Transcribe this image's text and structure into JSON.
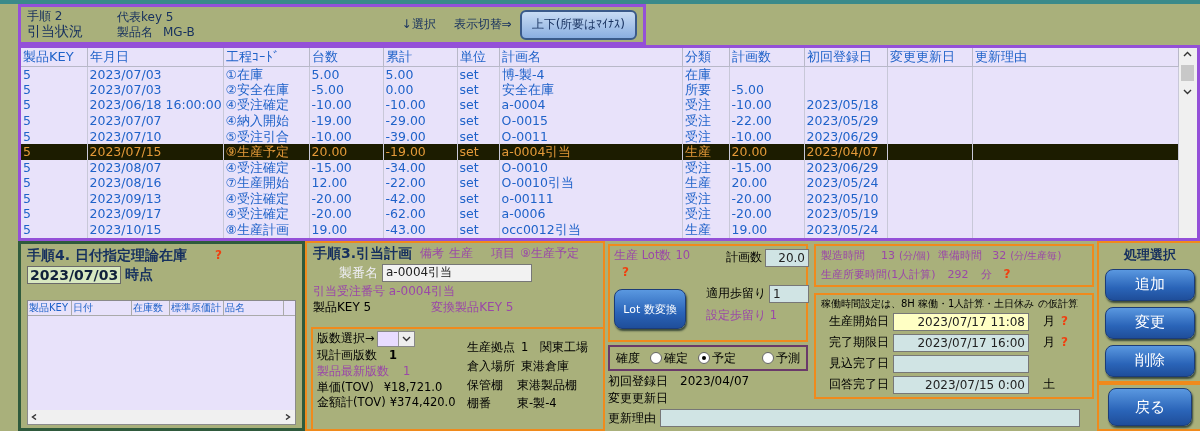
{
  "header": {
    "step": "手順 2",
    "title": "引当状況",
    "key_label": "代表key 5",
    "product_label": "製品名",
    "product_value": "MG-B",
    "select_hint": "↓選択",
    "toggle_label": "表示切替⇒",
    "toggle_button": "上下(所要はﾏｲﾅｽ)"
  },
  "table": {
    "columns": [
      "製品KEY",
      "年月日",
      "工程ｺｰﾄﾞ",
      "台数",
      "累計",
      "単位",
      "計画名",
      "分類",
      "計画数",
      "初回登録日",
      "変更更新日",
      "更新理由"
    ],
    "rows": [
      {
        "selected": false,
        "cells": [
          "5",
          "2023/07/03",
          "①在庫",
          "5.00",
          "5.00",
          "set",
          "博-製-4",
          "在庫",
          "",
          "",
          "",
          ""
        ]
      },
      {
        "selected": false,
        "cells": [
          "5",
          "2023/07/03",
          "②安全在庫",
          "-5.00",
          "0.00",
          "set",
          "安全在庫",
          "所要",
          "-5.00",
          "",
          "",
          ""
        ]
      },
      {
        "selected": false,
        "cells": [
          "5",
          "2023/06/18 16:00:00",
          "④受注確定",
          "-10.00",
          "-10.00",
          "set",
          "a-0004",
          "受注",
          "-10.00",
          "2023/05/18",
          "",
          ""
        ]
      },
      {
        "selected": false,
        "cells": [
          "5",
          "2023/07/07",
          "④納入開始",
          "-19.00",
          "-29.00",
          "set",
          "O-0015",
          "受注",
          "-22.00",
          "2023/05/29",
          "",
          ""
        ]
      },
      {
        "selected": false,
        "cells": [
          "5",
          "2023/07/10",
          "⑤受注引合",
          "-10.00",
          "-39.00",
          "set",
          "O-0011",
          "受注",
          "-10.00",
          "2023/06/29",
          "",
          ""
        ]
      },
      {
        "selected": true,
        "cells": [
          "5",
          "2023/07/15",
          "⑨生産予定",
          "20.00",
          "-19.00",
          "set",
          "a-0004引当",
          "生産",
          "20.00",
          "2023/04/07",
          "",
          ""
        ]
      },
      {
        "selected": false,
        "cells": [
          "5",
          "2023/08/07",
          "④受注確定",
          "-15.00",
          "-34.00",
          "set",
          "O-0010",
          "受注",
          "-15.00",
          "2023/06/29",
          "",
          ""
        ]
      },
      {
        "selected": false,
        "cells": [
          "5",
          "2023/08/16",
          "⑦生産開始",
          "12.00",
          "-22.00",
          "set",
          "O-0010引当",
          "生産",
          "20.00",
          "2023/05/24",
          "",
          ""
        ]
      },
      {
        "selected": false,
        "cells": [
          "5",
          "2023/09/13",
          "④受注確定",
          "-20.00",
          "-42.00",
          "set",
          "o-00111",
          "受注",
          "-20.00",
          "2023/05/10",
          "",
          ""
        ]
      },
      {
        "selected": false,
        "cells": [
          "5",
          "2023/09/17",
          "④受注確定",
          "-20.00",
          "-62.00",
          "set",
          "a-0006",
          "受注",
          "-20.00",
          "2023/05/19",
          "",
          ""
        ]
      },
      {
        "selected": false,
        "cells": [
          "5",
          "2023/10/15",
          "⑧生産計画",
          "19.00",
          "-43.00",
          "set",
          "occ0012引当",
          "生産",
          "19.00",
          "2023/05/24",
          "",
          ""
        ]
      }
    ]
  },
  "inventory": {
    "title": "手順4. 日付指定理論在庫",
    "help": "?",
    "date": "2023/07/03",
    "date_suffix": "時点",
    "columns": [
      "製品KEY",
      "日付",
      "在庫数",
      "標準原価計",
      "品名"
    ]
  },
  "plan": {
    "title": "手順3.引当計画",
    "note_label": "備考",
    "note": "生産",
    "item_label": "項目",
    "item": "⑨生産予定",
    "lot_name_label": "製番名",
    "lot_name": "a-0004引当",
    "order_no": "引当受注番号 a-0004引当",
    "product_key": "製品KEY 5",
    "converted_key": "変換製品KEY 5",
    "version_select": "版数選択→",
    "current_version_label": "現計画版数",
    "current_version": "1",
    "latest_version_label": "製品最新版数",
    "latest_version": "1",
    "unit_price_label": "単価(TOV)",
    "unit_price": "¥18,721.0",
    "total_label": "金額計(TOV)",
    "total": "¥374,420.0",
    "site_label": "生産拠点",
    "site": "1　関東工場",
    "storage_label": "倉入場所",
    "storage": "東港倉庫",
    "shelf_label": "保管棚",
    "shelf": "東港製品棚",
    "shelf_no_label": "棚番",
    "shelf_no": "東-製-4"
  },
  "lot": {
    "lot_label": "生産 Lot数",
    "lot": "10",
    "help": "?",
    "plan_count_label": "計画数",
    "plan_count": "20.0",
    "convert_button": "Lot 数変換",
    "yield_label": "適用歩留り",
    "yield": "1",
    "set_yield": "設定歩留り 1"
  },
  "certainty": {
    "label": "確度",
    "options": [
      {
        "label": "確定",
        "selected": false
      },
      {
        "label": "予定",
        "selected": true
      },
      {
        "label": "予測",
        "selected": false
      }
    ]
  },
  "record": {
    "first_label": "初回登録日",
    "first": "2023/04/07",
    "changed_label": "変更更新日",
    "reason_label": "更新理由"
  },
  "time": {
    "mfg_label": "製造時間",
    "mfg": "13",
    "mfg_unit": "(分/個)",
    "prep_label": "準備時間",
    "prep": "32",
    "prep_unit": "(分/生産毎)",
    "required_label": "生産所要時間(1人計算)",
    "required": "292",
    "required_unit": "分",
    "help": "?"
  },
  "schedule": {
    "note": "稼働時間設定は、8H 稼働・1人計算・土日休み の仮計算",
    "fields": [
      {
        "label": "生産開始日",
        "value": "2023/07/17 11:08",
        "weekday": "月",
        "highlighted": true,
        "help": "?"
      },
      {
        "label": "完了期限日",
        "value": "2023/07/17 16:00",
        "weekday": "月",
        "highlighted": false,
        "help": "?"
      },
      {
        "label": "見込完了日",
        "highlighted": false
      },
      {
        "label": "回答完了日",
        "value": "2023/07/15 0:00",
        "weekday": "土",
        "highlighted": false
      }
    ]
  },
  "actions": {
    "title": "処理選択",
    "buttons": [
      "追加",
      "変更",
      "削除"
    ],
    "back": "戻る"
  }
}
